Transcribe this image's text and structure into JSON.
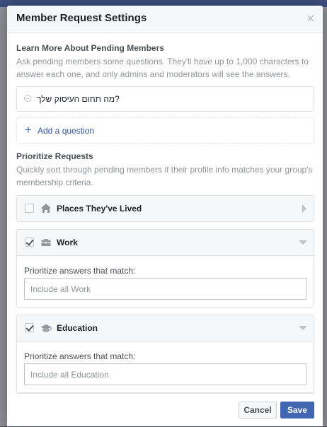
{
  "modal": {
    "title": "Member Request Settings",
    "close_symbol": "×"
  },
  "pending": {
    "title": "Learn More About Pending Members",
    "description": "Ask pending members some questions. They'll have up to 1,000 characters to answer each one, and only admins and moderators will see the answers.",
    "questions": [
      "?מה תחום העיסוק שלך"
    ],
    "add_question_label": "Add a question"
  },
  "prioritize": {
    "title": "Prioritize Requests",
    "description": "Quickly sort through pending members if their profile info matches your group's membership criteria.",
    "criteria": [
      {
        "label": "Places They've Lived",
        "checked": false,
        "expanded": false,
        "icon": "house-icon"
      },
      {
        "label": "Work",
        "checked": true,
        "expanded": true,
        "icon": "briefcase-icon",
        "match_label": "Prioritize answers that match:",
        "placeholder": "Include all Work"
      },
      {
        "label": "Education",
        "checked": true,
        "expanded": true,
        "icon": "graduation-cap-icon",
        "match_label": "Prioritize answers that match:",
        "placeholder": "Include all Education"
      }
    ]
  },
  "footer": {
    "cancel_label": "Cancel",
    "save_label": "Save"
  },
  "colors": {
    "accent": "#4267b2",
    "link": "#365899",
    "header_bg": "#f6f7f9"
  }
}
